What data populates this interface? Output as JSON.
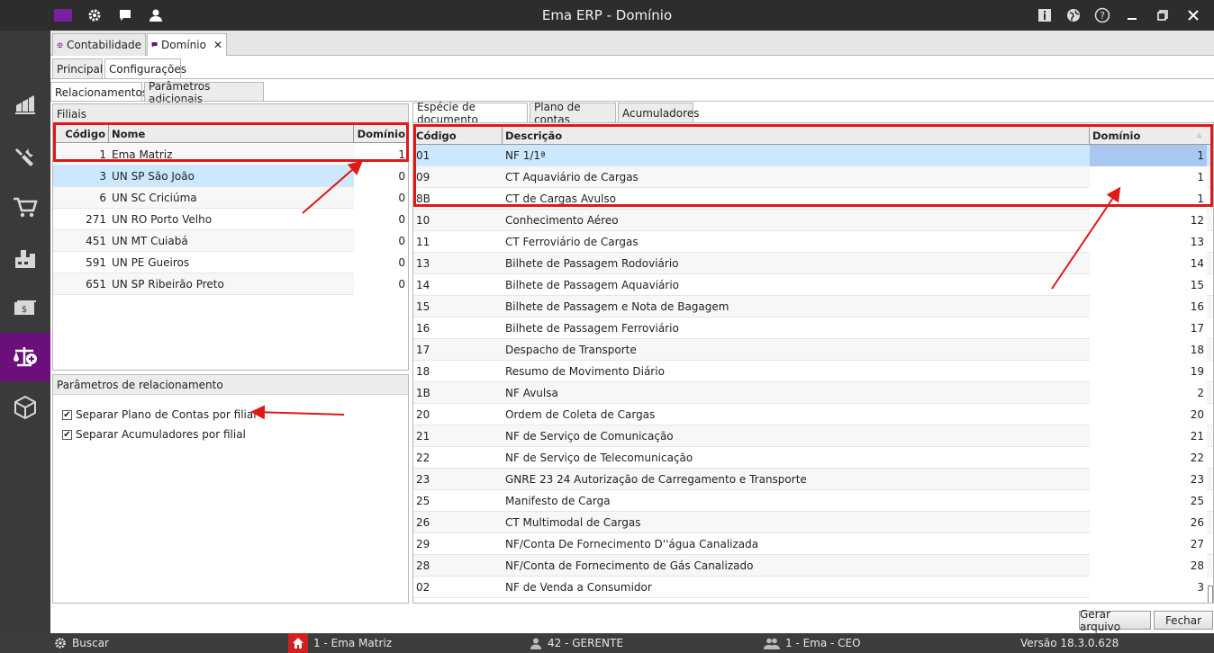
{
  "window": {
    "title": "Ema ERP - Domínio"
  },
  "titlebar": {
    "left_icons": [
      "logo-icon",
      "gear-icon",
      "chat-icon",
      "user-icon"
    ],
    "right_icons": [
      "info-icon",
      "globe-icon",
      "help-icon",
      "minimize-icon",
      "restore-icon",
      "close-icon"
    ]
  },
  "sidebar": {
    "items": [
      "chart-icon",
      "tools-icon",
      "cart-icon",
      "factory-icon",
      "money-icon",
      "scales-icon",
      "box-icon"
    ],
    "active_color": "#6b0f7c"
  },
  "doc_tabs": [
    {
      "label": "Contabilidade",
      "icon": "scales-icon"
    },
    {
      "label": "Domínio",
      "icon": "chat-icon",
      "closable": true,
      "close": "✕"
    }
  ],
  "page_tabs": [
    "Principal",
    "Configurações"
  ],
  "section_tabs": [
    "Relacionamentos",
    "Parâmetros adicionais"
  ],
  "filiais": {
    "title": "Filiais",
    "columns": [
      "Código",
      "Nome",
      "Domínio"
    ],
    "rows": [
      {
        "codigo": "1",
        "nome": "Ema Matriz",
        "dominio": "1"
      },
      {
        "codigo": "3",
        "nome": "UN SP São João",
        "dominio": "0"
      },
      {
        "codigo": "6",
        "nome": "UN SC Criciúma",
        "dominio": "0"
      },
      {
        "codigo": "271",
        "nome": "UN RO Porto Velho",
        "dominio": "0"
      },
      {
        "codigo": "451",
        "nome": "UN MT Cuiabá",
        "dominio": "0"
      },
      {
        "codigo": "591",
        "nome": "UN PE Gueiros",
        "dominio": "0"
      },
      {
        "codigo": "651",
        "nome": "UN SP Ribeirão Preto",
        "dominio": "0"
      }
    ]
  },
  "params": {
    "title": "Parâmetros de relacionamento",
    "checks": [
      {
        "label": "Separar Plano de Contas por filial",
        "checked": true
      },
      {
        "label": "Separar Acumuladores por filial",
        "checked": true
      }
    ],
    "check_mark": "✔"
  },
  "right_tabs": [
    "Espécie de documento",
    "Plano de contas",
    "Acumuladores"
  ],
  "especie": {
    "columns": [
      "Código",
      "Descrição",
      "Domínio"
    ],
    "sort_indicator": "▵",
    "rows": [
      {
        "codigo": "01",
        "descricao": "NF  1/1ª",
        "dominio": "1"
      },
      {
        "codigo": "09",
        "descricao": "CT Aquaviário de Cargas",
        "dominio": "1"
      },
      {
        "codigo": "8B",
        "descricao": "CT de Cargas Avulso",
        "dominio": "1"
      },
      {
        "codigo": "10",
        "descricao": "Conhecimento Aéreo",
        "dominio": "12"
      },
      {
        "codigo": "11",
        "descricao": "CT Ferroviário de Cargas",
        "dominio": "13"
      },
      {
        "codigo": "13",
        "descricao": "Bilhete de Passagem Rodoviário",
        "dominio": "14"
      },
      {
        "codigo": "14",
        "descricao": "Bilhete de Passagem Aquaviário",
        "dominio": "15"
      },
      {
        "codigo": "15",
        "descricao": "Bilhete de Passagem e Nota de Bagagem",
        "dominio": "16"
      },
      {
        "codigo": "16",
        "descricao": "Bilhete de Passagem Ferroviário",
        "dominio": "17"
      },
      {
        "codigo": "17",
        "descricao": "Despacho de Transporte",
        "dominio": "18"
      },
      {
        "codigo": "18",
        "descricao": "Resumo de Movimento Diário",
        "dominio": "19"
      },
      {
        "codigo": "1B",
        "descricao": "NF Avulsa",
        "dominio": "2"
      },
      {
        "codigo": "20",
        "descricao": "Ordem de Coleta de Cargas",
        "dominio": "20"
      },
      {
        "codigo": "21",
        "descricao": "NF de Serviço de Comunicação",
        "dominio": "21"
      },
      {
        "codigo": "22",
        "descricao": "NF de Serviço de Telecomunicação",
        "dominio": "22"
      },
      {
        "codigo": "23",
        "descricao": "GNRE  23 24  Autorização de Carregamento e Transporte",
        "dominio": "23"
      },
      {
        "codigo": "25",
        "descricao": "Manifesto de Carga",
        "dominio": "25"
      },
      {
        "codigo": "26",
        "descricao": "CT Multimodal de Cargas",
        "dominio": "26"
      },
      {
        "codigo": "29",
        "descricao": "NF/Conta De Fornecimento D''água Canalizada",
        "dominio": "27"
      },
      {
        "codigo": "28",
        "descricao": "NF/Conta de Fornecimento de Gás Canalizado",
        "dominio": "28"
      },
      {
        "codigo": "02",
        "descricao": "NF de Venda a Consumidor",
        "dominio": "3"
      }
    ]
  },
  "buttons": {
    "gerar": "Gerar arquivo",
    "fechar": "Fechar"
  },
  "statusbar": {
    "buscar": "Buscar",
    "empresa": "1 - Ema Matriz",
    "usuario": "42 - GERENTE",
    "perfil": "1 - Ema - CEO",
    "versao": "Versão 18.3.0.628"
  },
  "colors": {
    "highlight": "#e01818",
    "selected_row": "#cce8ff",
    "selected_cell": "#a8c8f0"
  }
}
